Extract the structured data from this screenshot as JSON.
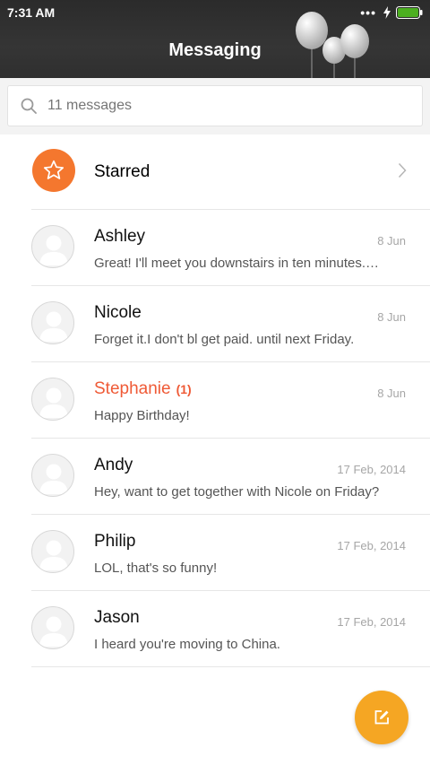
{
  "status_bar": {
    "time": "7:31 AM"
  },
  "header": {
    "title": "Messaging"
  },
  "search": {
    "placeholder": "11 messages"
  },
  "starred": {
    "label": "Starred"
  },
  "conversations": [
    {
      "name": "Ashley",
      "date": "8 Jun",
      "preview": "Great! I'll meet you downstairs in ten minutes.…",
      "unread": false
    },
    {
      "name": "Nicole",
      "date": "8 Jun",
      "preview": "Forget it.I don't bl get paid. until next Friday.",
      "unread": false
    },
    {
      "name": "Stephanie",
      "badge": "(1)",
      "date": "8 Jun",
      "preview": "Happy Birthday!",
      "unread": true
    },
    {
      "name": "Andy",
      "date": "17 Feb, 2014",
      "preview": "Hey, want to get together with Nicole on Friday?",
      "unread": false
    },
    {
      "name": "Philip",
      "date": "17 Feb, 2014",
      "preview": "LOL, that's so funny!",
      "unread": false
    },
    {
      "name": "Jason",
      "date": "17 Feb, 2014",
      "preview": "I heard you're moving to China.",
      "unread": false
    }
  ],
  "colors": {
    "accent_orange": "#f4772e",
    "unread_red": "#ef5a36",
    "fab_yellow": "#f5a623",
    "battery_green": "#4caf20"
  }
}
